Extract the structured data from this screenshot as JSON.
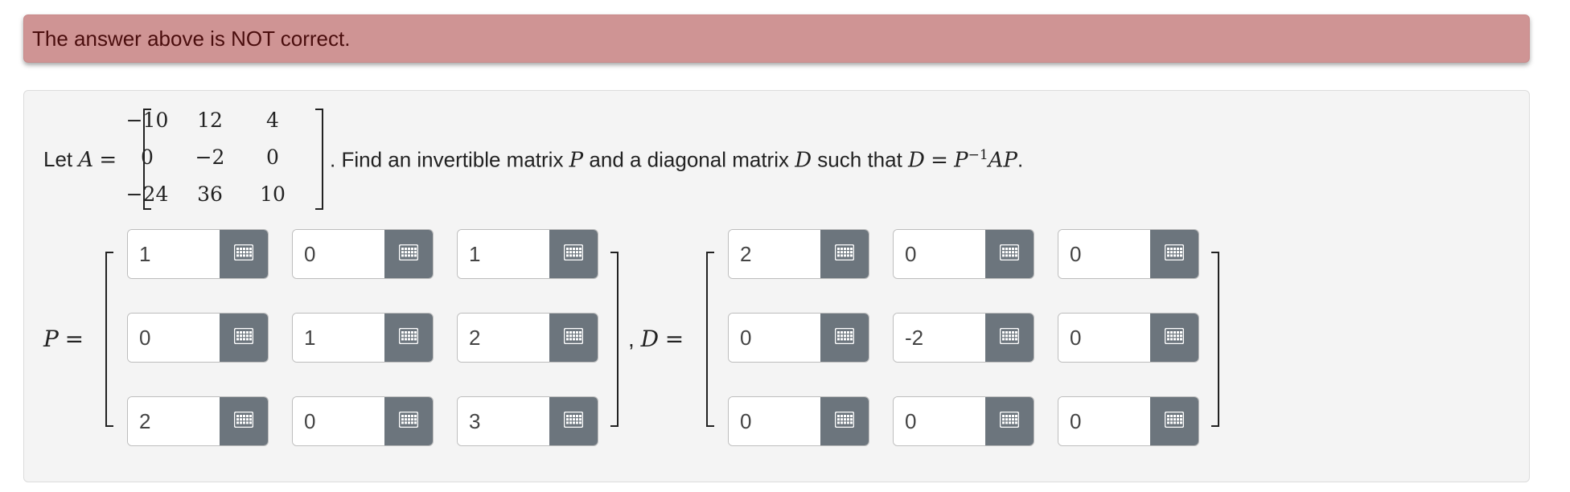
{
  "alert": {
    "text": "The answer above is NOT correct."
  },
  "problem": {
    "prefix": "Let ",
    "a_var": "A",
    "equals": "=",
    "sentence_1": ". Find an invertible matrix ",
    "p_var": "P",
    "sentence_2": " and a diagonal matrix ",
    "d_var": "D",
    "sentence_3": " such that ",
    "eq_lhs": "D",
    "eq_sign": "=",
    "eq_p": "P",
    "eq_exp": "−1",
    "eq_rest": "AP",
    "period": ".",
    "matrix_a": [
      [
        "−10",
        "12",
        "4"
      ],
      [
        "0",
        "−2",
        "0"
      ],
      [
        "−24",
        "36",
        "10"
      ]
    ]
  },
  "answer": {
    "p_label": "P",
    "p_equals": "=",
    "comma": ",",
    "d_label": "D",
    "d_equals": "=",
    "p_matrix": [
      [
        "1",
        "0",
        "1"
      ],
      [
        "0",
        "1",
        "2"
      ],
      [
        "2",
        "0",
        "3"
      ]
    ],
    "d_matrix": [
      [
        "2",
        "0",
        "0"
      ],
      [
        "0",
        "-2",
        "0"
      ],
      [
        "0",
        "0",
        "0"
      ]
    ],
    "keypad_icon": "keypad-icon"
  },
  "colors": {
    "alert_bg": "#cf9494",
    "alert_text": "#4a0d0d",
    "button_bg": "#6c757d",
    "panel_bg": "#f4f4f4"
  }
}
